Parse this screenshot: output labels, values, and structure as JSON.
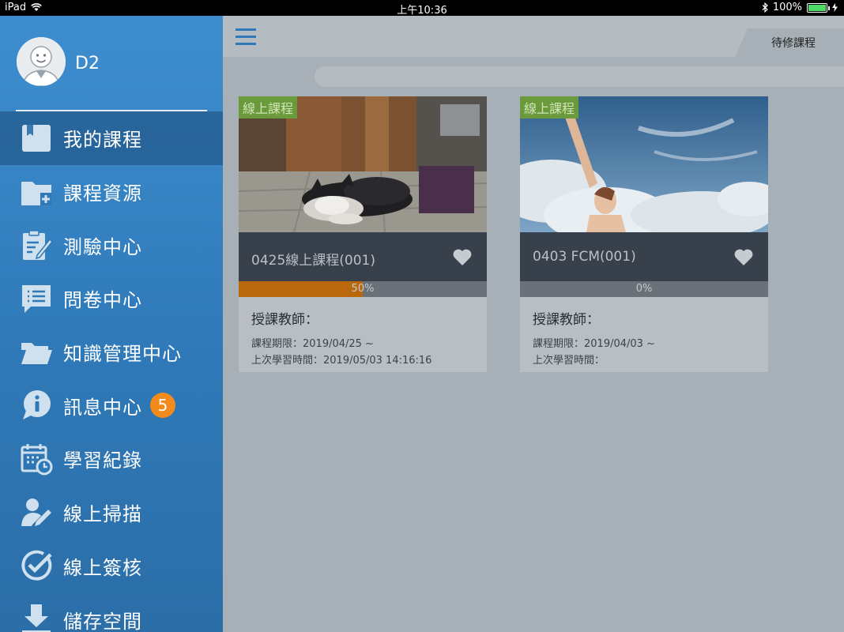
{
  "statusbar": {
    "device": "iPad",
    "time": "上午10:36",
    "battery_pct": "100%"
  },
  "sidebar": {
    "username": "D2",
    "items": [
      {
        "label": "我的課程",
        "icon": "book-icon",
        "active": true
      },
      {
        "label": "課程資源",
        "icon": "folder-add-icon"
      },
      {
        "label": "測驗中心",
        "icon": "quiz-clipboard-icon"
      },
      {
        "label": "問卷中心",
        "icon": "survey-chat-icon"
      },
      {
        "label": "知識管理中心",
        "icon": "folder-icon"
      },
      {
        "label": "訊息中心",
        "icon": "info-chat-icon",
        "badge": "5"
      },
      {
        "label": "學習紀錄",
        "icon": "calendar-clock-icon"
      },
      {
        "label": "線上掃描",
        "icon": "user-edit-icon"
      },
      {
        "label": "線上簽核",
        "icon": "check-circle-icon"
      },
      {
        "label": "儲存空間",
        "icon": "download-icon"
      }
    ]
  },
  "main": {
    "tab_label": "待修課程",
    "courses": [
      {
        "tag": "線上課程",
        "title": "0425線上課程(001)",
        "progress": 0.5,
        "progress_label": "50%",
        "teacher_label": "授課教師：",
        "period": "課程期限：2019/04/25 ~",
        "last_study": "上次學習時間：2019/05/03 14:16:16",
        "image": "husky-dog-photo"
      },
      {
        "tag": "線上課程",
        "title": "0403 FCM(001)",
        "progress": 0,
        "progress_label": "0%",
        "teacher_label": "授課教師：",
        "period": "課程期限：2019/04/03 ~",
        "last_study": "上次學習時間：",
        "image": "woman-sky-photo"
      }
    ]
  },
  "colors": {
    "sidebar_bg": "#2f79b8",
    "badge": "#f28a1c",
    "progress": "#b9690c",
    "tag": "#6b9a3c"
  }
}
